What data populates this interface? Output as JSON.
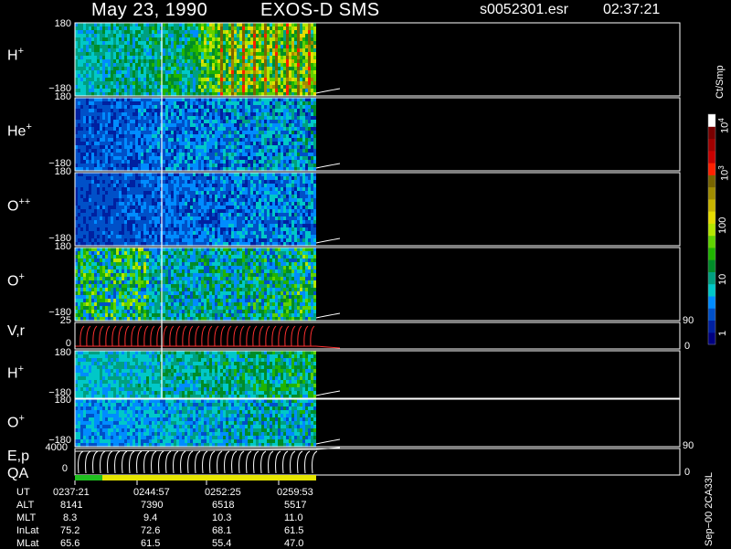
{
  "header": {
    "date": "May 23, 1990",
    "instrument": "EXOS-D SMS",
    "file": "s0052301.esr",
    "time": "02:37:21"
  },
  "panels": [
    {
      "label": "H",
      "charge": "+",
      "ymax": "180",
      "ymin": "−180"
    },
    {
      "label": "He",
      "charge": "+",
      "ymax": "180",
      "ymin": "−180"
    },
    {
      "label": "O",
      "charge": "++",
      "ymax": "180",
      "ymin": "−180"
    },
    {
      "label": "O",
      "charge": "+",
      "ymax": "180",
      "ymin": "−180"
    },
    {
      "label": "V,r",
      "charge": "",
      "ymax": "25",
      "ymin": "0",
      "rmax": "90",
      "rmin": "0"
    },
    {
      "label": "H",
      "charge": "+",
      "ymax": "180",
      "ymin": "−180"
    },
    {
      "label": "O",
      "charge": "+",
      "ymax": "180",
      "ymin": "−180"
    },
    {
      "label": "E,p",
      "charge": "",
      "ymax": "4000",
      "ymin": "0",
      "rmax": "90",
      "rmin": "0"
    }
  ],
  "qa_label": "QA",
  "colorbar": {
    "unit": "Ct/Smp",
    "tick_labels": [
      "1",
      "10",
      "100",
      "10",
      "10"
    ],
    "tick_exponents": [
      "",
      "",
      "",
      "3",
      "4"
    ],
    "colors": [
      "#000080",
      "#0020a0",
      "#0050c8",
      "#008cff",
      "#00c8c8",
      "#00a080",
      "#008c28",
      "#20b400",
      "#60d200",
      "#b4e600",
      "#e6dc00",
      "#c8b400",
      "#a08c00",
      "#786400",
      "#ff2000",
      "#c80000",
      "#a00000",
      "#780000",
      "#ffffff"
    ]
  },
  "ephemeris": {
    "labels": [
      "UT",
      "ALT",
      "MLT",
      "InLat",
      "MLat"
    ],
    "columns": [
      {
        "UT": "0237:21",
        "ALT": "8141",
        "MLT": "8.3",
        "InLat": "75.2",
        "MLat": "65.6"
      },
      {
        "UT": "0244:57",
        "ALT": "7390",
        "MLT": "9.4",
        "InLat": "72.6",
        "MLat": "61.5"
      },
      {
        "UT": "0252:25",
        "ALT": "6518",
        "MLT": "10.3",
        "InLat": "68.1",
        "MLat": "55.4"
      },
      {
        "UT": "0259:53",
        "ALT": "5517",
        "MLT": "11.0",
        "InLat": "61.5",
        "MLat": "47.0"
      }
    ]
  },
  "footer_version": "Sep−00 2CA33L",
  "chart_data": {
    "type": "heatmap",
    "title": "May 23, 1990   EXOS-D SMS",
    "xlabel": "UT",
    "x_ticks": [
      "0237:21",
      "0244:57",
      "0252:25",
      "0259:53"
    ],
    "panels": [
      {
        "name": "H+",
        "ylim": [
          -180,
          180
        ]
      },
      {
        "name": "He+",
        "ylim": [
          -180,
          180
        ]
      },
      {
        "name": "O++",
        "ylim": [
          -180,
          180
        ]
      },
      {
        "name": "O+",
        "ylim": [
          -180,
          180
        ]
      },
      {
        "name": "V,r",
        "ylim": [
          0,
          25
        ],
        "y2lim": [
          0,
          90
        ]
      },
      {
        "name": "H+",
        "ylim": [
          -180,
          180
        ]
      },
      {
        "name": "O+",
        "ylim": [
          -180,
          180
        ]
      },
      {
        "name": "E,p",
        "ylim": [
          0,
          4000
        ],
        "y2lim": [
          0,
          90
        ]
      }
    ],
    "colorscale": {
      "unit": "Ct/Smp",
      "range": [
        1,
        10000
      ],
      "log": true
    }
  }
}
